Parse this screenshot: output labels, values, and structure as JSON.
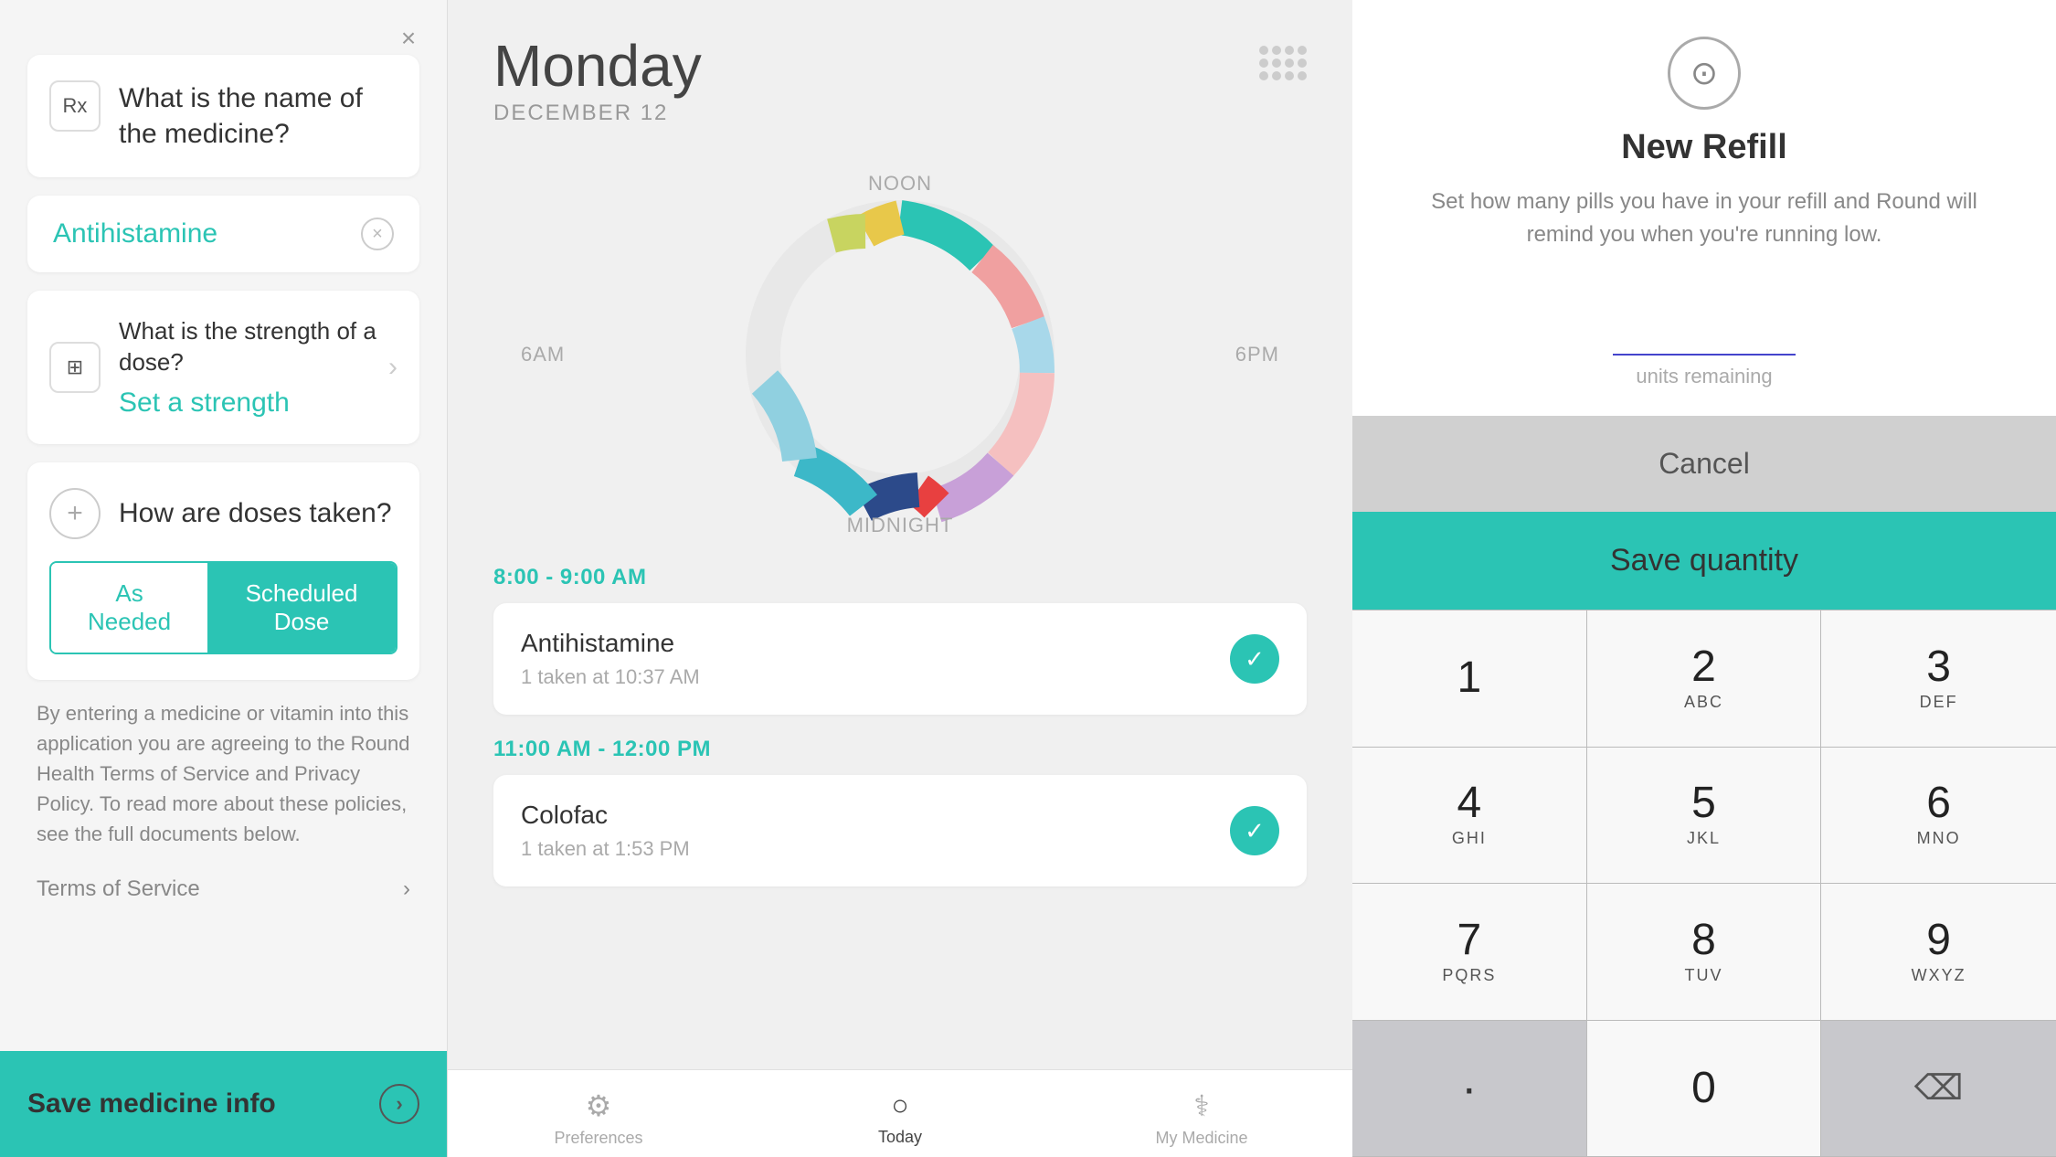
{
  "leftPanel": {
    "closeLabel": "×",
    "question1": {
      "icon": "Rx",
      "text": "What is the name of the medicine?"
    },
    "answer1": {
      "text": "Antihistamine"
    },
    "question2": {
      "iconUnicode": "⊞",
      "text": "What is the strength of a dose?"
    },
    "answer2": {
      "text": "Set a strength"
    },
    "question3": {
      "text": "How are doses taken?"
    },
    "toggleAs": "As Needed",
    "toggleScheduled": "Scheduled Dose",
    "legalText": "By entering a medicine or vitamin into this application you are agreeing to the Round Health Terms of Service and Privacy Policy. To read more about these policies, see the full documents below.",
    "termsLabel": "Terms of Service",
    "saveLabel": "Save medicine info"
  },
  "middlePanel": {
    "dayLabel": "Monday",
    "dateLabel": "DECEMBER 12",
    "timeLabels": {
      "noon": "NOON",
      "sixAM": "6AM",
      "sixPM": "6PM",
      "midnight": "MIDNIGHT"
    },
    "scheduleItems": [
      {
        "timeRange": "8:00 - 9:00 AM",
        "medName": "Antihistamine",
        "medTime": "1 taken at 10:37 AM",
        "checked": true
      },
      {
        "timeRange": "11:00 AM - 12:00 PM",
        "medName": "Colofac",
        "medTime": "1 taken at 1:53 PM",
        "checked": true
      }
    ],
    "nav": {
      "preferencesLabel": "Preferences",
      "todayLabel": "Today",
      "myMedicineLabel": "My Medicine"
    }
  },
  "rightPanel": {
    "refillTitle": "New Refill",
    "refillDesc": "Set how many pills you have in your refill and Round will remind you when you're running low.",
    "unitsLabel": "units remaining",
    "cancelLabel": "Cancel",
    "saveQtyLabel": "Save quantity",
    "numpad": [
      {
        "number": "1",
        "letters": ""
      },
      {
        "number": "2",
        "letters": "ABC"
      },
      {
        "number": "3",
        "letters": "DEF"
      },
      {
        "number": "4",
        "letters": "GHI"
      },
      {
        "number": "5",
        "letters": "JKL"
      },
      {
        "number": "6",
        "letters": "MNO"
      },
      {
        "number": "7",
        "letters": "PQRS"
      },
      {
        "number": "8",
        "letters": "TUV"
      },
      {
        "number": "9",
        "letters": "WXYZ"
      },
      {
        "number": ".",
        "letters": ""
      },
      {
        "number": "0",
        "letters": ""
      },
      {
        "number": "⌫",
        "letters": ""
      }
    ]
  }
}
